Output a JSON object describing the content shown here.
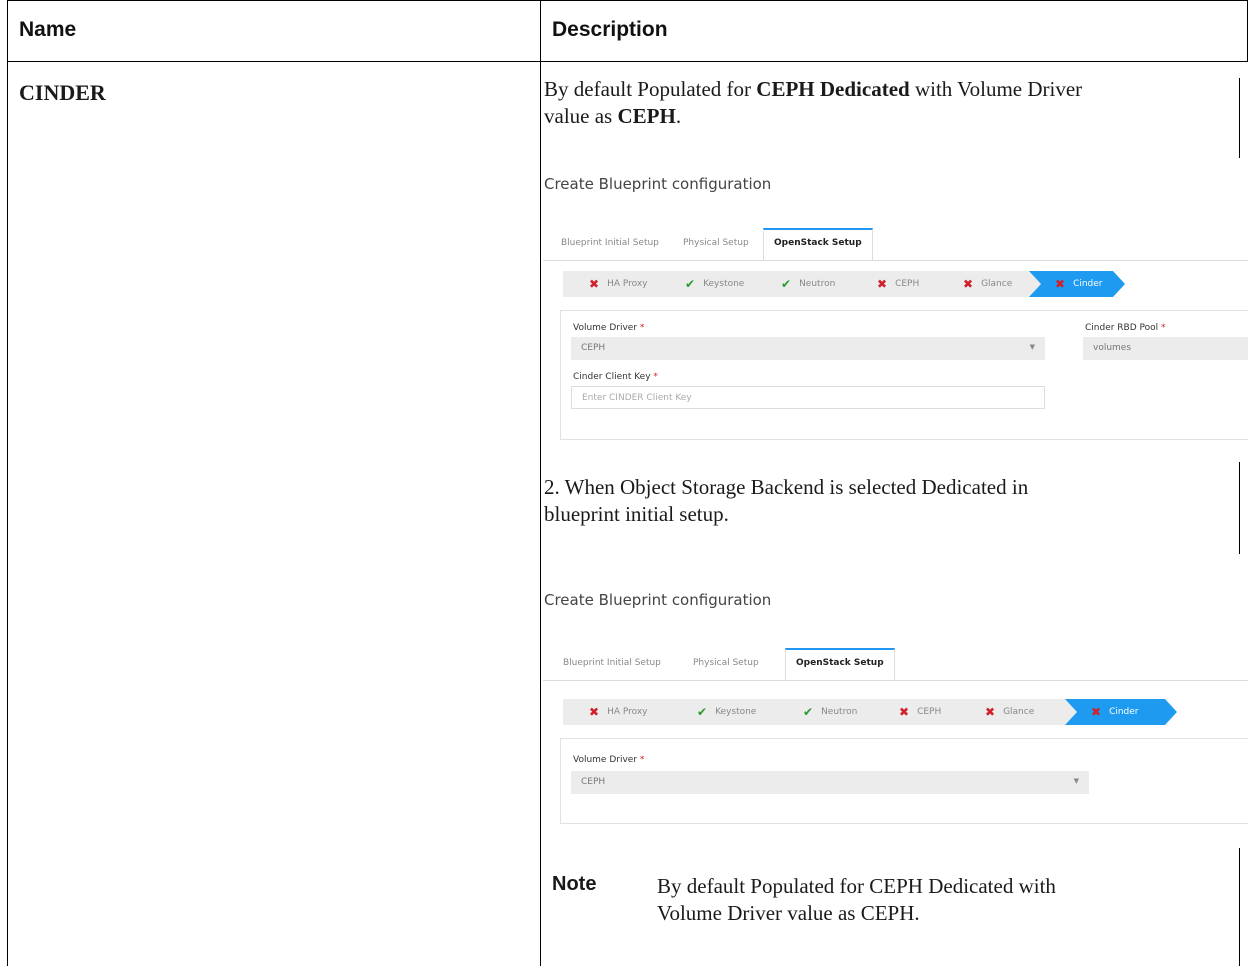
{
  "table": {
    "headers": [
      "Name",
      "Description"
    ],
    "row": {
      "name": "CINDER",
      "desc1": {
        "pre": "By default Populated for ",
        "bold1": "CEPH Dedicated",
        "mid": " with Volume Driver",
        "line2_pre": "value as ",
        "bold2": "CEPH",
        "line2_post": "."
      },
      "desc2": {
        "line1": "2. When Object Storage Backend is selected Dedicated in",
        "line2": "blueprint initial setup."
      },
      "note": {
        "label": "Note",
        "line1": "By default Populated for CEPH Dedicated with",
        "line2": "Volume Driver value as CEPH."
      }
    }
  },
  "figure1": {
    "title": "Create Blueprint configuration",
    "tabs": [
      "Blueprint Initial Setup",
      "Physical Setup",
      "OpenStack Setup"
    ],
    "steps": [
      {
        "label": "HA Proxy",
        "status": "x"
      },
      {
        "label": "Keystone",
        "status": "ok"
      },
      {
        "label": "Neutron",
        "status": "ok"
      },
      {
        "label": "CEPH",
        "status": "x"
      },
      {
        "label": "Glance",
        "status": "x"
      },
      {
        "label": "Cinder",
        "status": "x"
      }
    ],
    "volume_driver_label": "Volume Driver",
    "volume_driver_value": "CEPH",
    "rbd_pool_label": "Cinder RBD Pool",
    "rbd_pool_value": "volumes",
    "client_key_label": "Cinder Client Key",
    "client_key_placeholder": "Enter CINDER Client Key"
  },
  "figure2": {
    "title": "Create Blueprint configuration",
    "tabs": [
      "Blueprint Initial Setup",
      "Physical Setup",
      "OpenStack Setup"
    ],
    "steps": [
      {
        "label": "HA Proxy",
        "status": "x"
      },
      {
        "label": "Keystone",
        "status": "ok"
      },
      {
        "label": "Neutron",
        "status": "ok"
      },
      {
        "label": "CEPH",
        "status": "x"
      },
      {
        "label": "Glance",
        "status": "x"
      },
      {
        "label": "Cinder",
        "status": "x"
      }
    ],
    "volume_driver_label": "Volume Driver",
    "volume_driver_value": "CEPH"
  },
  "colors": {
    "accent": "#1e9bf0",
    "error": "#d0202a",
    "success": "#2a9a2a",
    "icons": {
      "x": "close-icon",
      "ok": "checkmark-icon"
    }
  }
}
